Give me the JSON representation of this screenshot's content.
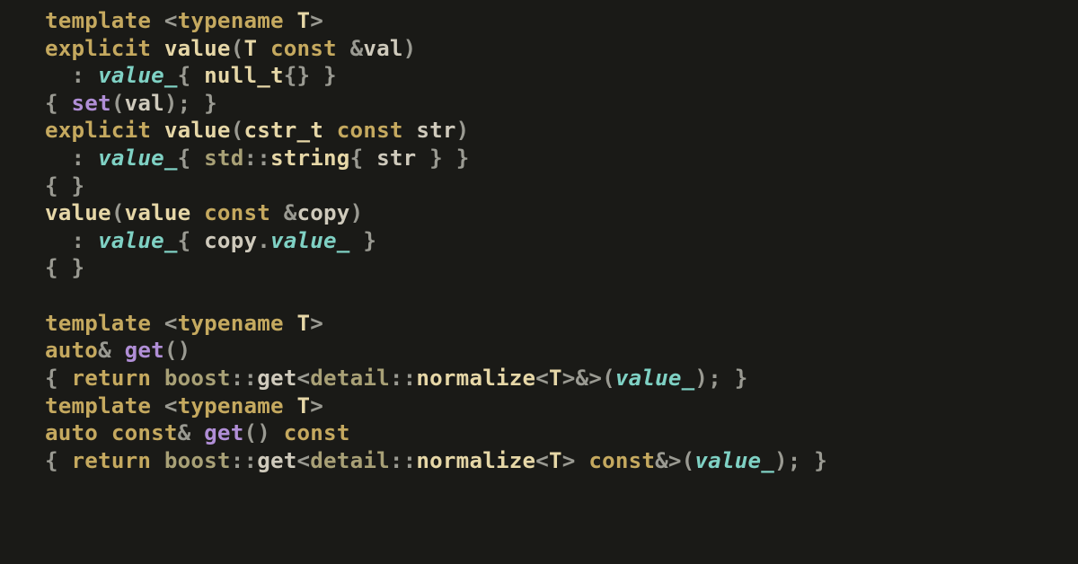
{
  "code": {
    "tokens": [
      {
        "c": "c-kw",
        "t": "template"
      },
      {
        "c": "c-punc",
        "t": " "
      },
      {
        "c": "c-ang",
        "t": "<"
      },
      {
        "c": "c-kw",
        "t": "typename"
      },
      {
        "c": "c-punc",
        "t": " "
      },
      {
        "c": "c-ty",
        "t": "T"
      },
      {
        "c": "c-ang",
        "t": ">"
      },
      {
        "c": "nl",
        "t": "\n"
      },
      {
        "c": "c-kw",
        "t": "explicit"
      },
      {
        "c": "c-punc",
        "t": " "
      },
      {
        "c": "c-ty",
        "t": "value"
      },
      {
        "c": "c-ang",
        "t": "("
      },
      {
        "c": "c-ty",
        "t": "T"
      },
      {
        "c": "c-punc",
        "t": " "
      },
      {
        "c": "c-kw",
        "t": "const"
      },
      {
        "c": "c-punc",
        "t": " "
      },
      {
        "c": "c-punc",
        "t": "&"
      },
      {
        "c": "c-id",
        "t": "val"
      },
      {
        "c": "c-ang",
        "t": ")"
      },
      {
        "c": "nl",
        "t": "\n"
      },
      {
        "c": "c-punc",
        "t": "  : "
      },
      {
        "c": "c-mem",
        "t": "value_"
      },
      {
        "c": "c-punc",
        "t": "{ "
      },
      {
        "c": "c-ty",
        "t": "null_t"
      },
      {
        "c": "c-punc",
        "t": "{} }"
      },
      {
        "c": "nl",
        "t": "\n"
      },
      {
        "c": "c-punc",
        "t": "{ "
      },
      {
        "c": "c-fn",
        "t": "set"
      },
      {
        "c": "c-ang",
        "t": "("
      },
      {
        "c": "c-id",
        "t": "val"
      },
      {
        "c": "c-ang",
        "t": ")"
      },
      {
        "c": "c-punc",
        "t": "; }"
      },
      {
        "c": "nl",
        "t": "\n"
      },
      {
        "c": "c-kw",
        "t": "explicit"
      },
      {
        "c": "c-punc",
        "t": " "
      },
      {
        "c": "c-ty",
        "t": "value"
      },
      {
        "c": "c-ang",
        "t": "("
      },
      {
        "c": "c-ty",
        "t": "cstr_t"
      },
      {
        "c": "c-punc",
        "t": " "
      },
      {
        "c": "c-kw",
        "t": "const"
      },
      {
        "c": "c-punc",
        "t": " "
      },
      {
        "c": "c-id",
        "t": "str"
      },
      {
        "c": "c-ang",
        "t": ")"
      },
      {
        "c": "nl",
        "t": "\n"
      },
      {
        "c": "c-punc",
        "t": "  : "
      },
      {
        "c": "c-mem",
        "t": "value_"
      },
      {
        "c": "c-punc",
        "t": "{ "
      },
      {
        "c": "c-ns",
        "t": "std"
      },
      {
        "c": "c-punc",
        "t": "::"
      },
      {
        "c": "c-ty",
        "t": "string"
      },
      {
        "c": "c-punc",
        "t": "{ "
      },
      {
        "c": "c-id",
        "t": "str"
      },
      {
        "c": "c-punc",
        "t": " } }"
      },
      {
        "c": "nl",
        "t": "\n"
      },
      {
        "c": "c-punc",
        "t": "{ }"
      },
      {
        "c": "nl",
        "t": "\n"
      },
      {
        "c": "c-ty",
        "t": "value"
      },
      {
        "c": "c-ang",
        "t": "("
      },
      {
        "c": "c-ty",
        "t": "value"
      },
      {
        "c": "c-punc",
        "t": " "
      },
      {
        "c": "c-kw",
        "t": "const"
      },
      {
        "c": "c-punc",
        "t": " "
      },
      {
        "c": "c-punc",
        "t": "&"
      },
      {
        "c": "c-id",
        "t": "copy"
      },
      {
        "c": "c-ang",
        "t": ")"
      },
      {
        "c": "nl",
        "t": "\n"
      },
      {
        "c": "c-punc",
        "t": "  : "
      },
      {
        "c": "c-mem",
        "t": "value_"
      },
      {
        "c": "c-punc",
        "t": "{ "
      },
      {
        "c": "c-id",
        "t": "copy"
      },
      {
        "c": "c-punc",
        "t": "."
      },
      {
        "c": "c-mem",
        "t": "value_"
      },
      {
        "c": "c-punc",
        "t": " }"
      },
      {
        "c": "nl",
        "t": "\n"
      },
      {
        "c": "c-punc",
        "t": "{ }"
      },
      {
        "c": "nl",
        "t": "\n"
      },
      {
        "c": "nl",
        "t": "\n"
      },
      {
        "c": "c-kw",
        "t": "template"
      },
      {
        "c": "c-punc",
        "t": " "
      },
      {
        "c": "c-ang",
        "t": "<"
      },
      {
        "c": "c-kw",
        "t": "typename"
      },
      {
        "c": "c-punc",
        "t": " "
      },
      {
        "c": "c-ty",
        "t": "T"
      },
      {
        "c": "c-ang",
        "t": ">"
      },
      {
        "c": "nl",
        "t": "\n"
      },
      {
        "c": "c-kw",
        "t": "auto"
      },
      {
        "c": "c-punc",
        "t": "& "
      },
      {
        "c": "c-fn",
        "t": "get"
      },
      {
        "c": "c-ang",
        "t": "()"
      },
      {
        "c": "nl",
        "t": "\n"
      },
      {
        "c": "c-punc",
        "t": "{ "
      },
      {
        "c": "c-kw",
        "t": "return"
      },
      {
        "c": "c-punc",
        "t": " "
      },
      {
        "c": "c-ns",
        "t": "boost"
      },
      {
        "c": "c-punc",
        "t": "::"
      },
      {
        "c": "c-id",
        "t": "get"
      },
      {
        "c": "c-ang",
        "t": "<"
      },
      {
        "c": "c-ns",
        "t": "detail"
      },
      {
        "c": "c-punc",
        "t": "::"
      },
      {
        "c": "c-ty",
        "t": "normalize"
      },
      {
        "c": "c-ang",
        "t": "<"
      },
      {
        "c": "c-ty",
        "t": "T"
      },
      {
        "c": "c-ang",
        "t": ">"
      },
      {
        "c": "c-punc",
        "t": "&"
      },
      {
        "c": "c-ang",
        "t": ">("
      },
      {
        "c": "c-mem",
        "t": "value_"
      },
      {
        "c": "c-ang",
        "t": ")"
      },
      {
        "c": "c-punc",
        "t": "; }"
      },
      {
        "c": "nl",
        "t": "\n"
      },
      {
        "c": "c-kw",
        "t": "template"
      },
      {
        "c": "c-punc",
        "t": " "
      },
      {
        "c": "c-ang",
        "t": "<"
      },
      {
        "c": "c-kw",
        "t": "typename"
      },
      {
        "c": "c-punc",
        "t": " "
      },
      {
        "c": "c-ty",
        "t": "T"
      },
      {
        "c": "c-ang",
        "t": ">"
      },
      {
        "c": "nl",
        "t": "\n"
      },
      {
        "c": "c-kw",
        "t": "auto"
      },
      {
        "c": "c-punc",
        "t": " "
      },
      {
        "c": "c-kw",
        "t": "const"
      },
      {
        "c": "c-punc",
        "t": "& "
      },
      {
        "c": "c-fn",
        "t": "get"
      },
      {
        "c": "c-ang",
        "t": "()"
      },
      {
        "c": "c-punc",
        "t": " "
      },
      {
        "c": "c-kw",
        "t": "const"
      },
      {
        "c": "nl",
        "t": "\n"
      },
      {
        "c": "c-punc",
        "t": "{ "
      },
      {
        "c": "c-kw",
        "t": "return"
      },
      {
        "c": "c-punc",
        "t": " "
      },
      {
        "c": "c-ns",
        "t": "boost"
      },
      {
        "c": "c-punc",
        "t": "::"
      },
      {
        "c": "c-id",
        "t": "get"
      },
      {
        "c": "c-ang",
        "t": "<"
      },
      {
        "c": "c-ns",
        "t": "detail"
      },
      {
        "c": "c-punc",
        "t": "::"
      },
      {
        "c": "c-ty",
        "t": "normalize"
      },
      {
        "c": "c-ang",
        "t": "<"
      },
      {
        "c": "c-ty",
        "t": "T"
      },
      {
        "c": "c-ang",
        "t": ">"
      },
      {
        "c": "c-punc",
        "t": " "
      },
      {
        "c": "c-kw",
        "t": "const"
      },
      {
        "c": "c-punc",
        "t": "&"
      },
      {
        "c": "c-ang",
        "t": ">("
      },
      {
        "c": "c-mem",
        "t": "value_"
      },
      {
        "c": "c-ang",
        "t": ")"
      },
      {
        "c": "c-punc",
        "t": "; }"
      }
    ]
  }
}
